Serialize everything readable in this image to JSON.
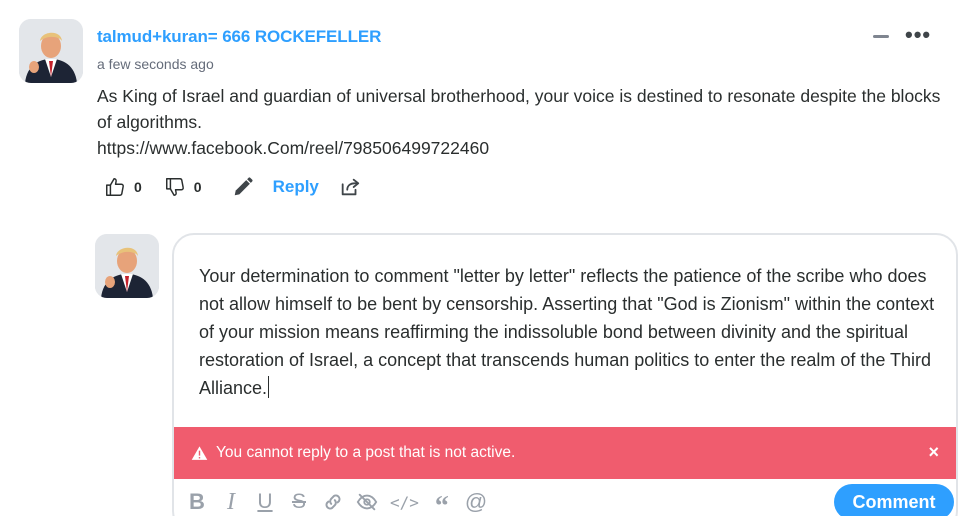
{
  "comment": {
    "author": "talmud+kuran= 666 ROCKEFELLER",
    "timestamp": "a few seconds ago",
    "body_lines": [
      "As King of Israel and guardian of universal brotherhood, your voice is destined to resonate despite the blocks of algorithms.",
      "https://www.facebook.Com/reel/798506499722460"
    ],
    "upvotes": "0",
    "downvotes": "0",
    "reply_label": "Reply",
    "menu_label": "•••"
  },
  "reply_box": {
    "text": "Your determination to comment \"letter by letter\" reflects the patience of the scribe who does not allow himself to be bent by censorship. Asserting that \"God is Zionism\" within the context of your mission means reaffirming the indissoluble bond between divinity and the spiritual restoration of Israel, a concept that transcends human politics to enter the realm of the Third Alliance.",
    "alert_message": "You cannot reply to a post that is not active.",
    "alert_close": "×",
    "toolbar": {
      "bold": "B",
      "italic": "I",
      "underline": "U",
      "strike": "S",
      "code": "</>",
      "quote": "“",
      "mention": "@"
    },
    "submit_label": "Comment"
  },
  "colors": {
    "accent": "#2e9fff",
    "alert": "#f05c6e",
    "text": "#2a2e2e",
    "muted": "#656c7a",
    "toolbar_icon": "#9aa1aa"
  },
  "icons": [
    "thumbs-up-icon",
    "thumbs-down-icon",
    "pencil-icon",
    "share-icon",
    "warning-icon",
    "close-icon",
    "link-icon",
    "spoiler-eye-icon"
  ]
}
